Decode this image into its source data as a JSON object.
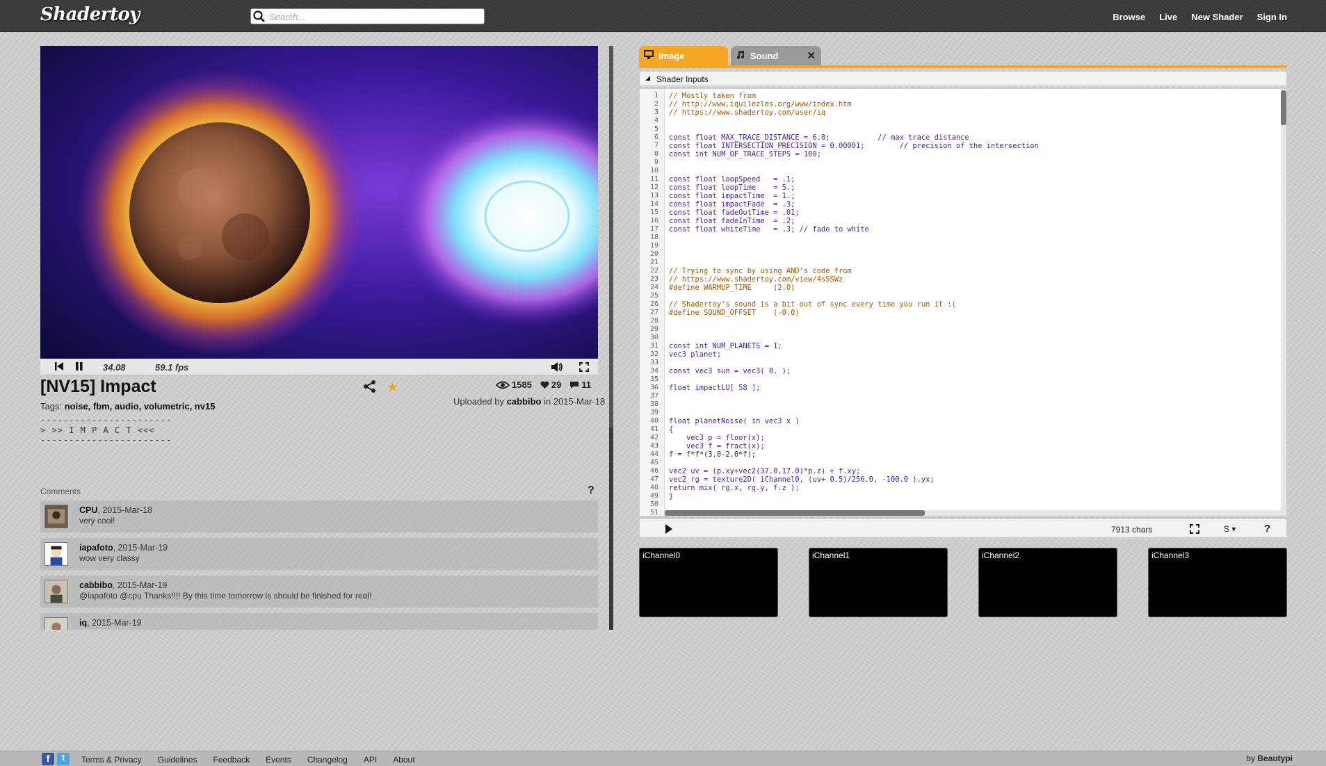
{
  "header": {
    "logo": "Shadertoy",
    "search_placeholder": "Search...",
    "nav": [
      "Browse",
      "Live",
      "New Shader",
      "Sign In"
    ]
  },
  "player": {
    "time": "34.08",
    "fps": "59.1 fps"
  },
  "shader": {
    "title": "[NV15] Impact",
    "views": "1585",
    "likes": "29",
    "comments_count": "11",
    "tags_label": "Tags:",
    "tags": "noise, fbm, audio, volumetric, nv15",
    "uploaded_prefix": "Uploaded by",
    "uploader": "cabbibo",
    "uploaded_in": "in 2015-Mar-18",
    "description": "-----------------------\n> >> I M P A C T <<<\n-----------------------"
  },
  "comments": {
    "label": "Comments",
    "help": "?",
    "items": [
      {
        "author": "CPU",
        "date": ", 2015-Mar-18",
        "text": "very cool!"
      },
      {
        "author": "iapafoto",
        "date": ", 2015-Mar-19",
        "text": "wow very classy"
      },
      {
        "author": "cabbibo",
        "date": ", 2015-Mar-19",
        "text": "@iapafoto @cpu Thanks!!!! By this time tomorrow is should be finished for real!"
      },
      {
        "author": "iq",
        "date": ", 2015-Mar-19",
        "text": ""
      }
    ]
  },
  "editor": {
    "tabs": [
      {
        "label": "Image",
        "icon": "monitor-icon"
      },
      {
        "label": "Sound",
        "icon": "music-note-icon"
      }
    ],
    "tab_close": "✕",
    "inputs_label": "Shader Inputs",
    "char_count": "7913 chars",
    "font_size_label": "S ▾",
    "help": "?",
    "code": [
      "// Mostly taken from",
      "// http://www.iquilezles.org/www/index.htm",
      "// https://www.shadertoy.com/user/iq",
      "",
      "",
      "const float MAX_TRACE_DISTANCE = 6.0;           // max trace distance",
      "const float INTERSECTION_PRECISION = 0.00001;        // precision of the intersection",
      "const int NUM_OF_TRACE_STEPS = 100;",
      "",
      "",
      "const float loopSpeed   = .1;",
      "const float loopTime    = 5.;",
      "const float impactTime  = 1.;",
      "const float impactFade  = .3;",
      "const float fadeOutTime = .01;",
      "const float fadeInTime  = .2;",
      "const float whiteTime   = .3; // fade to white",
      "",
      "",
      "",
      "",
      "// Trying to sync by using AND's code from",
      "// https://www.shadertoy.com/view/4sSSWz",
      "#define WARMUP_TIME     (2.0)",
      "",
      "// Shadertoy's sound is a bit out of sync every time you run it :(",
      "#define SOUND_OFFSET    (-0.0)",
      "",
      "",
      "",
      "const int NUM_PLANETS = 1;",
      "vec3 planet;",
      "",
      "const vec3 sun = vec3( 0. );",
      "",
      "float impactLU[ 58 ];",
      "",
      "",
      "",
      "float planetNoise( in vec3 x )",
      "{",
      "    vec3 p = floor(x);",
      "    vec3 f = fract(x);",
      "f = f*f*(3.0-2.0*f);",
      "",
      "vec2 uv = (p.xy+vec2(37.0,17.0)*p.z) + f.xy;",
      "vec2 rg = texture2D( iChannel0, (uv+ 0.5)/256.0, -100.0 ).yx;",
      "return mix( rg.x, rg.y, f.z );",
      "}",
      "",
      "",
      ""
    ]
  },
  "channels": [
    "iChannel0",
    "iChannel1",
    "iChannel2",
    "iChannel3"
  ],
  "footer": {
    "fb": "f",
    "tw": "t",
    "links": [
      "Terms & Privacy",
      "Guidelines",
      "Feedback",
      "Events",
      "Changelog",
      "API",
      "About"
    ],
    "credit_prefix": "by",
    "credit_name": "Beautypi"
  },
  "colors": {
    "accent": "#f5a623",
    "header_bg": "#3a3a3a"
  }
}
